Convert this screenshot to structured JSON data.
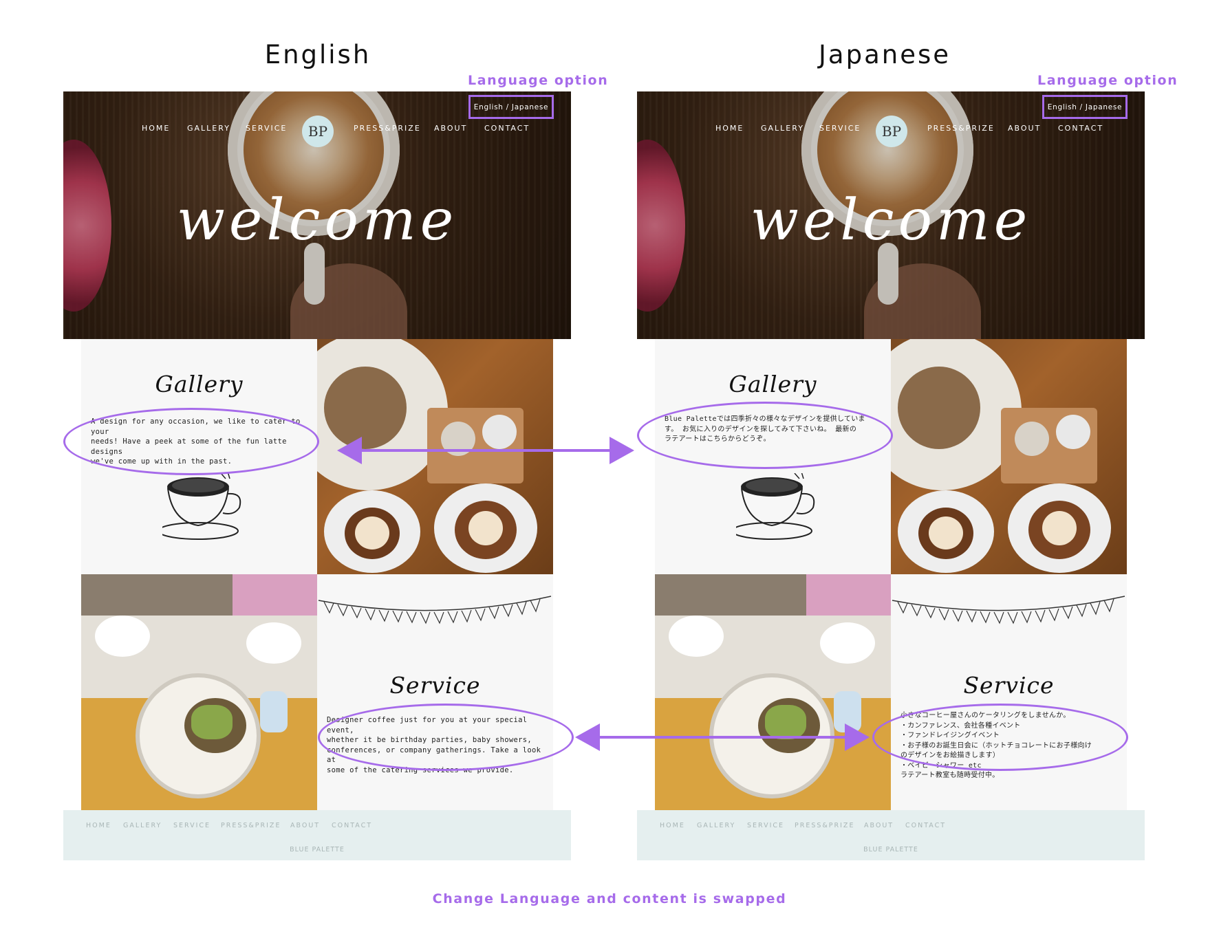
{
  "columns": [
    {
      "heading": "English",
      "annotation": "Language option",
      "lang_toggle": "English / Japanese",
      "nav": [
        "HOME",
        "GALLERY",
        "SERVICE",
        "PRESS&PRIZE",
        "ABOUT",
        "CONTACT"
      ],
      "logo": "BP",
      "hero_title": "welcome",
      "gallery": {
        "title": "Gallery",
        "lines": [
          "A design for any occasion, we like to cater to your",
          "needs! Have a peek at some of the fun latte designs",
          "we've come up with in the past."
        ]
      },
      "service": {
        "title": "Service",
        "lines": [
          "Designer coffee just for you at your special event,",
          "whether it be birthday parties, baby showers,",
          "conferences, or company gatherings. Take a look at",
          "some of the catering services we provide."
        ]
      },
      "footer": {
        "nav": [
          "HOME",
          "GALLERY",
          "SERVICE",
          "PRESS&PRIZE",
          "ABOUT",
          "CONTACT"
        ],
        "brand": "BLUE PALETTE"
      }
    },
    {
      "heading": "Japanese",
      "annotation": "Language option",
      "lang_toggle": "English / Japanese",
      "nav": [
        "HOME",
        "GALLERY",
        "SERVICE",
        "PRESS&PRIZE",
        "ABOUT",
        "CONTACT"
      ],
      "logo": "BP",
      "hero_title": "welcome",
      "gallery": {
        "title": "Gallery",
        "lines": [
          "Blue Paletteでは四季折々の様々なデザインを提供していま",
          "す。 お気に入りのデザインを探してみて下さいね。 最新の",
          "ラテアートはこちらからどうぞ。"
        ]
      },
      "service": {
        "title": "Service",
        "lines": [
          "小さなコーヒー屋さんのケータリングをしませんか。",
          "・カンファレンス、会社各種イベント",
          "・ファンドレイジングイベント",
          "・お子様のお誕生日会に（ホットチョコレートにお子様向け",
          "のデザインをお絵描きします）",
          "・ベイビーシャワー etc",
          "ラテアート教室も随時受付中。"
        ]
      },
      "footer": {
        "nav": [
          "HOME",
          "GALLERY",
          "SERVICE",
          "PRESS&PRIZE",
          "ABOUT",
          "CONTACT"
        ],
        "brand": "BLUE PALETTE"
      }
    }
  ],
  "caption": "Change Language and content is swapped",
  "colors": {
    "accent": "#a66bea",
    "footer_bg": "#e5efef",
    "panel_bg": "#f7f7f7"
  },
  "icons": [
    "logo-badge",
    "coffee-cup-sketch-icon",
    "bunting-sketch",
    "double-arrow-icon"
  ]
}
